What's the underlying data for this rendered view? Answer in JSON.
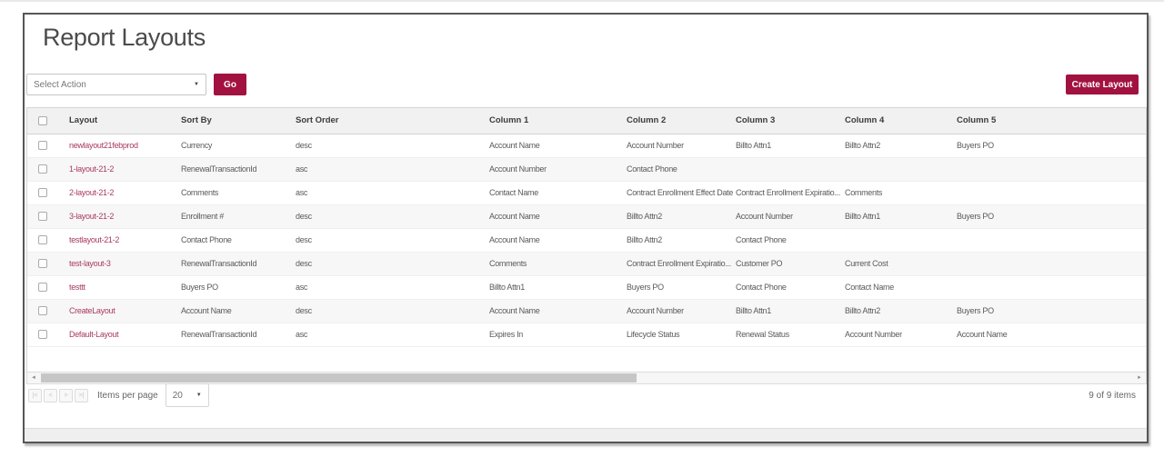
{
  "page": {
    "title": "Report Layouts"
  },
  "toolbar": {
    "action_select_value": "Select Action",
    "go_label": "Go",
    "create_layout_label": "Create Layout"
  },
  "table": {
    "columns": [
      "Layout",
      "Sort By",
      "Sort Order",
      "Column 1",
      "Column 2",
      "Column 3",
      "Column 4",
      "Column 5"
    ],
    "rows": [
      {
        "layout": "newlayout21febprod",
        "sort_by": "Currency",
        "sort_order": "desc",
        "col1": "Account Name",
        "col2": "Account Number",
        "col3": "Billto Attn1",
        "col4": "Billto Attn2",
        "col5": "Buyers PO"
      },
      {
        "layout": "1-layout-21-2",
        "sort_by": "RenewalTransactionId",
        "sort_order": "asc",
        "col1": "Account Number",
        "col2": "Contact Phone",
        "col3": "",
        "col4": "",
        "col5": ""
      },
      {
        "layout": "2-layout-21-2",
        "sort_by": "Comments",
        "sort_order": "asc",
        "col1": "Contact Name",
        "col2": "Contract Enrollment Effect Date",
        "col3": "Contract Enrollment Expiratio...",
        "col4": "Comments",
        "col5": ""
      },
      {
        "layout": "3-layout-21-2",
        "sort_by": "Enrollment #",
        "sort_order": "desc",
        "col1": "Account Name",
        "col2": "Billto Attn2",
        "col3": "Account Number",
        "col4": "Billto Attn1",
        "col5": "Buyers PO"
      },
      {
        "layout": "testlayout-21-2",
        "sort_by": "Contact Phone",
        "sort_order": "desc",
        "col1": "Account Name",
        "col2": "Billto Attn2",
        "col3": "Contact Phone",
        "col4": "",
        "col5": ""
      },
      {
        "layout": "test-layout-3",
        "sort_by": "RenewalTransactionId",
        "sort_order": "desc",
        "col1": "Comments",
        "col2": "Contract Enrollment Expiratio...",
        "col3": "Customer PO",
        "col4": "Current Cost",
        "col5": ""
      },
      {
        "layout": "testtt",
        "sort_by": "Buyers PO",
        "sort_order": "asc",
        "col1": "Billto Attn1",
        "col2": "Buyers PO",
        "col3": "Contact Phone",
        "col4": "Contact Name",
        "col5": ""
      },
      {
        "layout": "CreateLayout",
        "sort_by": "Account Name",
        "sort_order": "desc",
        "col1": "Account Name",
        "col2": "Account Number",
        "col3": "Billto Attn1",
        "col4": "Billto Attn2",
        "col5": "Buyers PO"
      },
      {
        "layout": "Default-Layout",
        "sort_by": "RenewalTransactionId",
        "sort_order": "asc",
        "col1": "Expires In",
        "col2": "Lifecycle Status",
        "col3": "Renewal Status",
        "col4": "Account Number",
        "col5": "Account Name"
      }
    ]
  },
  "pager": {
    "items_per_page_label": "Items per page",
    "page_size": "20",
    "summary": "9 of 9 items"
  },
  "icons": {
    "select_caret": "▼",
    "page_size_caret": "▼",
    "pager_first": "|<",
    "pager_prev": "<",
    "pager_next": ">",
    "pager_last": ">|",
    "scroll_left": "◄",
    "scroll_right": "►"
  },
  "colors": {
    "accent": "#A21240",
    "link_text": "#A93A5E",
    "table_header_bg": "#F1F1F1",
    "row_alt_bg": "#F7F7F7"
  }
}
